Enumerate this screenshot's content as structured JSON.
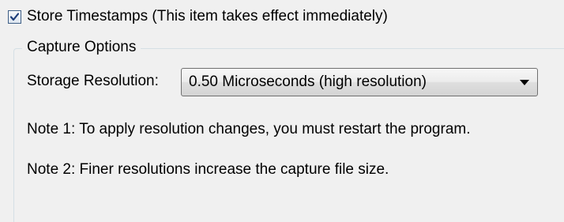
{
  "store_timestamps": {
    "checked": true,
    "label": "Store Timestamps (This item takes effect immediately)"
  },
  "capture_options": {
    "title": "Capture Options",
    "storage_resolution": {
      "label": "Storage Resolution:",
      "selected": "0.50 Microseconds (high resolution)"
    },
    "note1": "Note 1: To apply resolution changes, you must restart the program.",
    "note2": "Note 2: Finer resolutions increase the capture file size."
  }
}
